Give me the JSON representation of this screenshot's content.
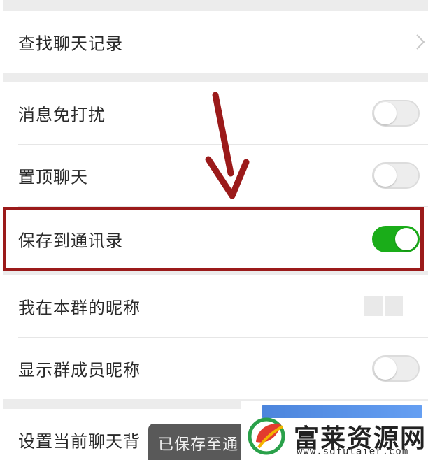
{
  "settings": {
    "search_history": {
      "label": "查找聊天记录"
    },
    "mute": {
      "label": "消息免打扰",
      "on": false
    },
    "sticky": {
      "label": "置顶聊天",
      "on": false
    },
    "save_contacts": {
      "label": "保存到通讯录",
      "on": true
    },
    "my_nickname": {
      "label": "我在本群的昵称"
    },
    "show_nicknames": {
      "label": "显示群成员昵称",
      "on": false
    },
    "background": {
      "label": "设置当前聊天背"
    }
  },
  "toast": {
    "text": "已保存至通"
  },
  "watermark": {
    "title": "富莱资源网",
    "url": "www.sdfulaier.com"
  },
  "colors": {
    "toggle_on": "#1aad19",
    "highlight": "#9b1a1a",
    "section_gap": "#ececec"
  },
  "icons": {
    "chevron": "chevron-right-icon",
    "arrow": "down-arrow-icon",
    "logo": "leaf-logo-icon"
  }
}
